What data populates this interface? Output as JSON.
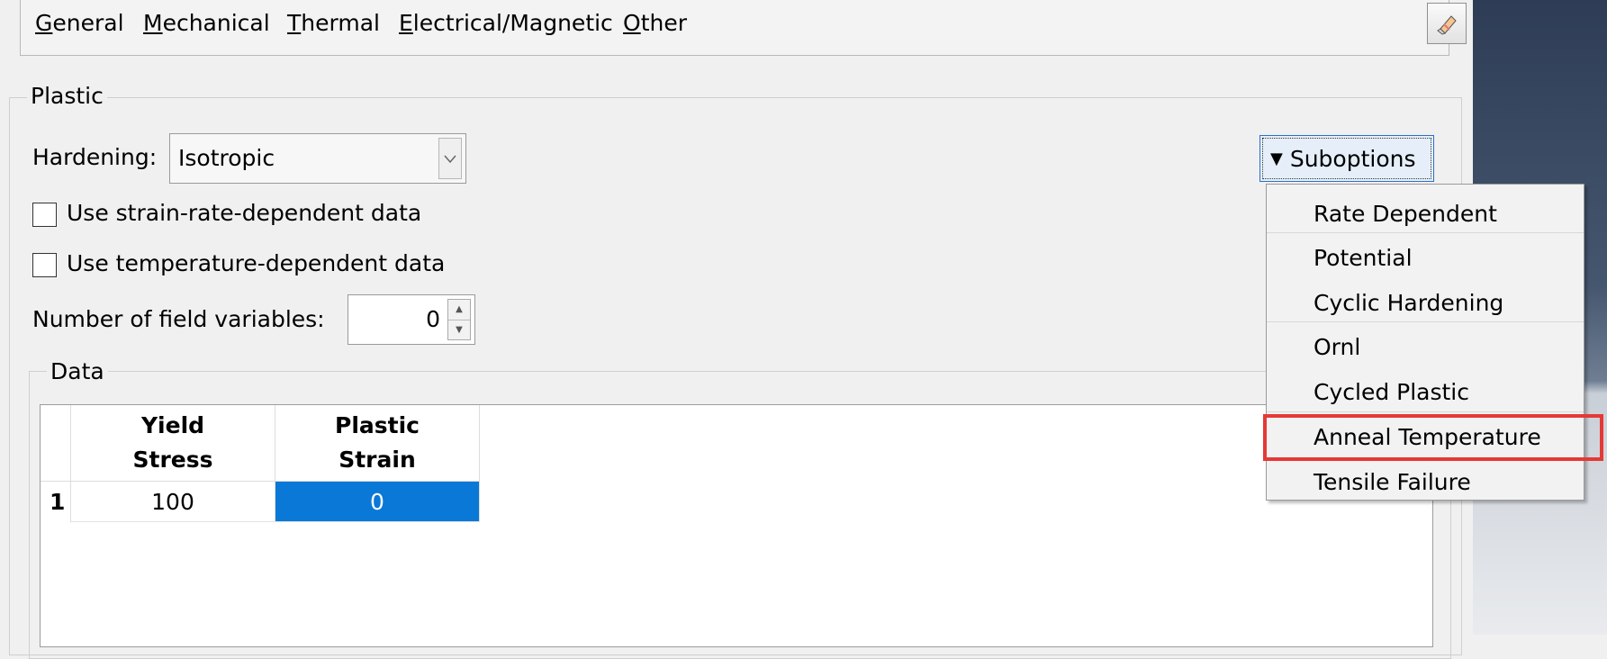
{
  "menubar": {
    "items": [
      {
        "key": "G",
        "rest": "eneral"
      },
      {
        "key": "M",
        "rest": "echanical"
      },
      {
        "key": "T",
        "rest": "hermal"
      },
      {
        "key": "E",
        "rest": "lectrical/Magnetic"
      },
      {
        "key": "O",
        "rest": "ther"
      }
    ],
    "edit_icon": "eraser-icon"
  },
  "plastic": {
    "title": "Plastic",
    "hardening_label": "Hardening:",
    "hardening_value": "Isotropic",
    "strain_rate_label": "Use strain-rate-dependent data",
    "strain_rate_checked": false,
    "temperature_label": "Use temperature-dependent data",
    "temperature_checked": false,
    "field_vars_label": "Number of field variables:",
    "field_vars_value": "0",
    "suboptions_label": "Suboptions"
  },
  "data": {
    "title": "Data",
    "columns": [
      "Yield\nStress",
      "Plastic\nStrain"
    ],
    "rows": [
      {
        "index": "1",
        "cells": [
          "100",
          "0"
        ]
      }
    ]
  },
  "suboptions_menu": {
    "items": [
      "Rate Dependent",
      "Potential",
      "Cyclic Hardening",
      "Ornl",
      "Cycled Plastic",
      "Anneal Temperature",
      "Tensile Failure"
    ],
    "highlighted": "Anneal Temperature",
    "highlight_color": "#e53935"
  },
  "colors": {
    "selection": "#0a78d7",
    "accent_border": "#2a6fc9"
  }
}
